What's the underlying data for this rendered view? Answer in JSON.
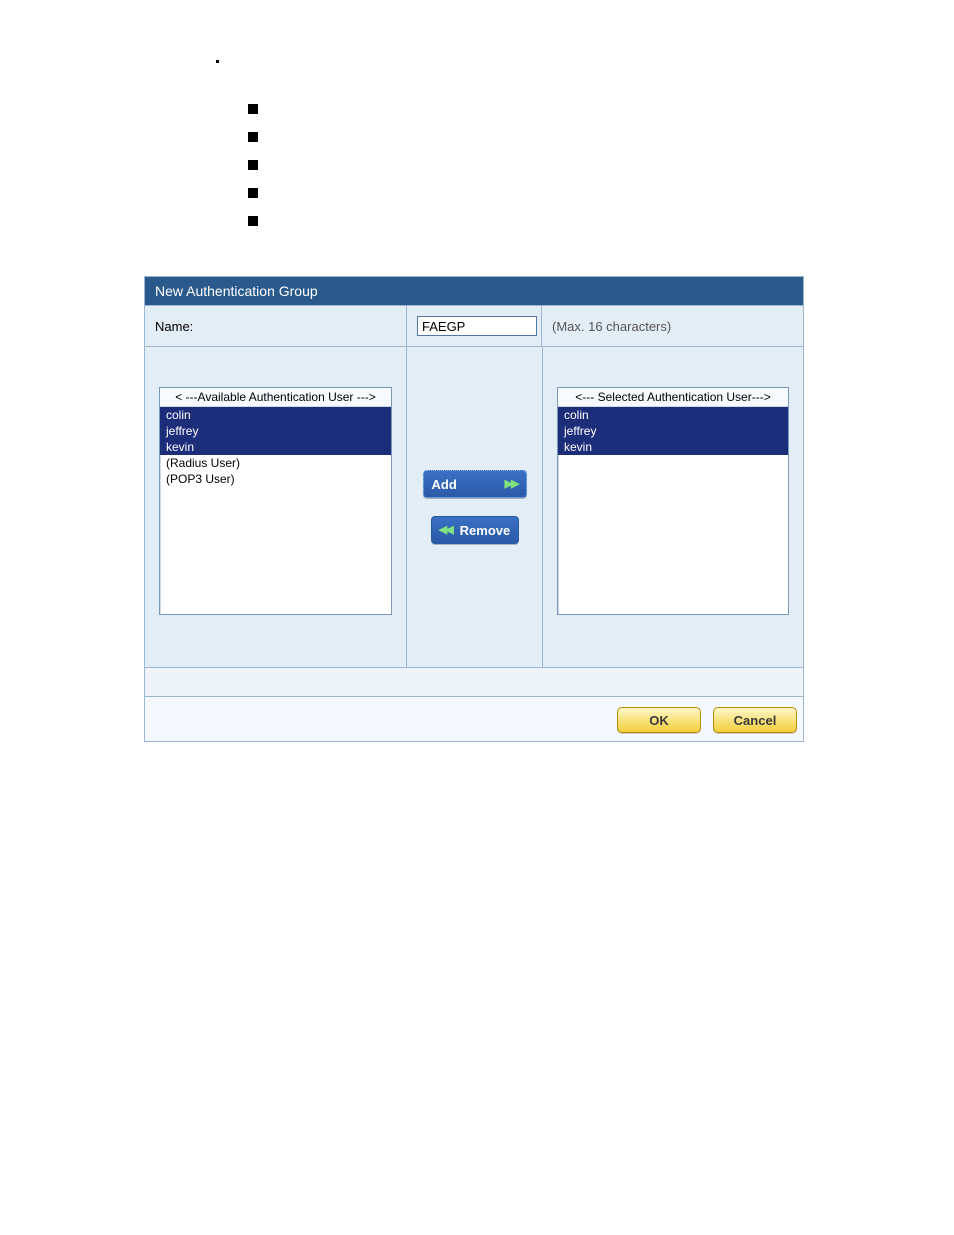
{
  "panel": {
    "title": "New Authentication Group",
    "name_label": "Name:",
    "name_value": "FAEGP",
    "name_hint": "(Max. 16 characters)"
  },
  "available": {
    "title": "< ---Available Authentication User --->",
    "items": [
      {
        "label": "colin",
        "selected": true
      },
      {
        "label": "jeffrey",
        "selected": true
      },
      {
        "label": "kevin",
        "selected": true
      },
      {
        "label": "(Radius User)",
        "selected": false
      },
      {
        "label": "(POP3 User)",
        "selected": false
      }
    ]
  },
  "selected": {
    "title": "<--- Selected Authentication User--->",
    "items": [
      {
        "label": "colin",
        "selected": true
      },
      {
        "label": "jeffrey",
        "selected": true
      },
      {
        "label": "kevin",
        "selected": true
      }
    ]
  },
  "buttons": {
    "add": "Add",
    "remove": "Remove",
    "ok": "OK",
    "cancel": "Cancel"
  }
}
